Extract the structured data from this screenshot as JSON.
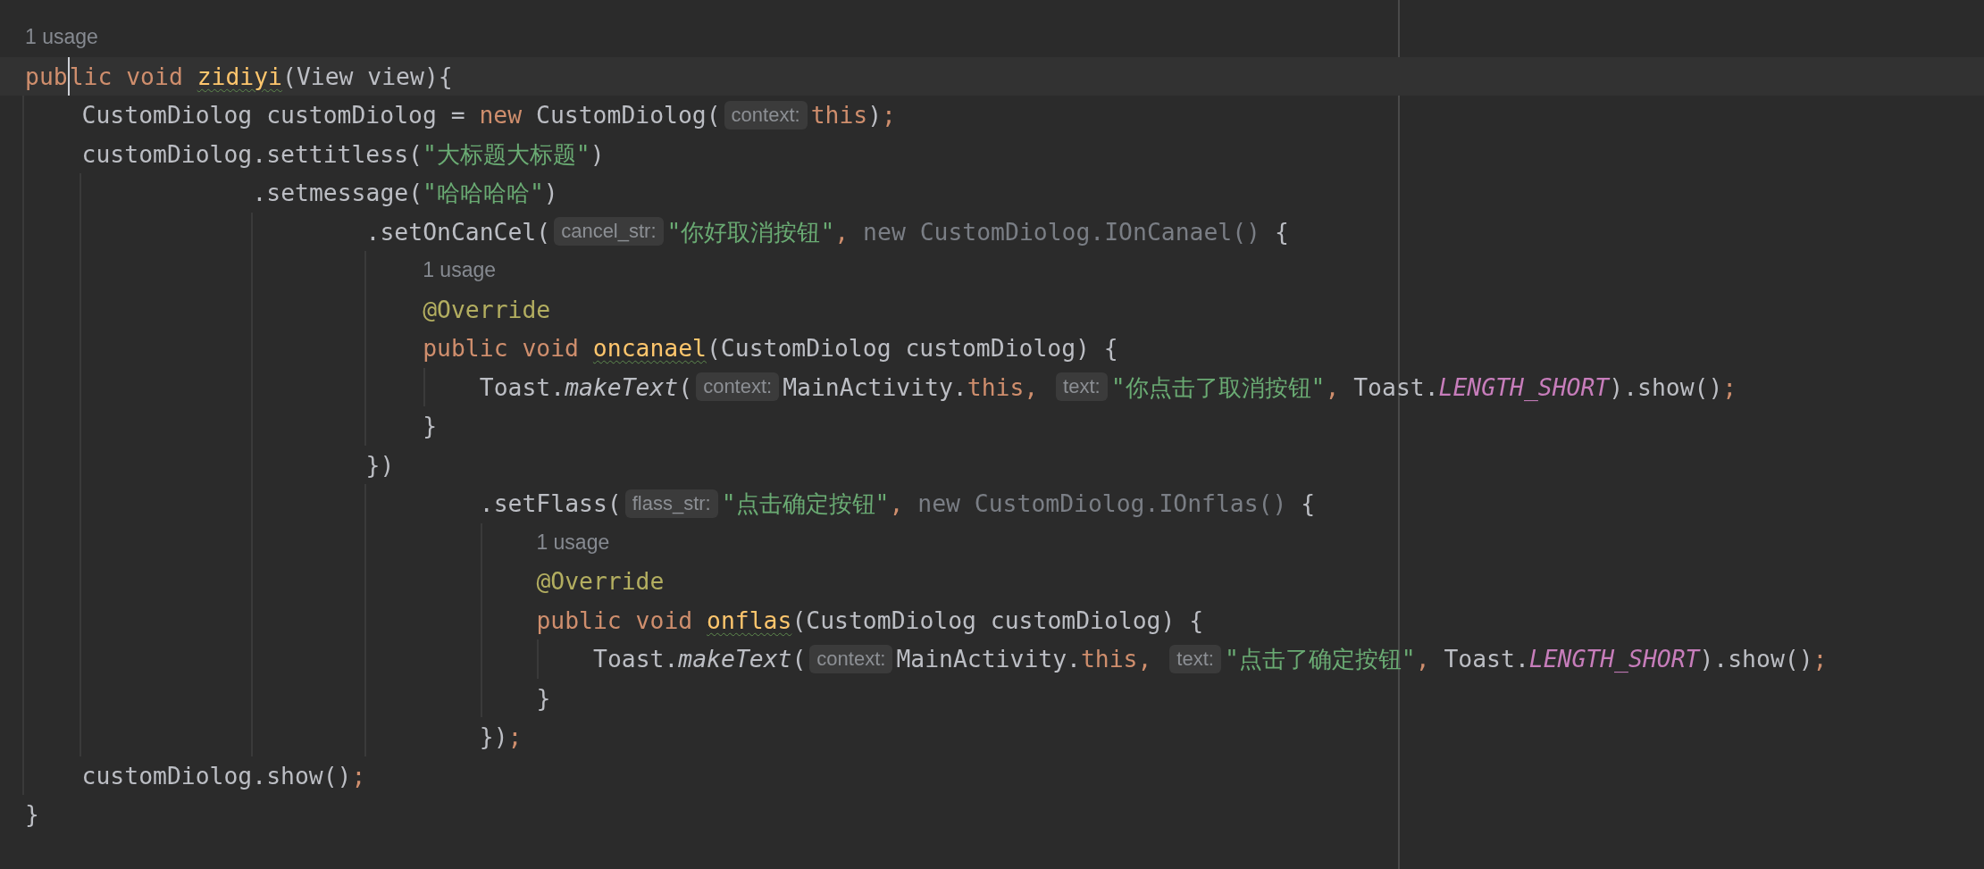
{
  "editor": {
    "lines": [
      {
        "current": false,
        "tokens": [
          {
            "kind": "usage",
            "text": "1 usage"
          }
        ]
      },
      {
        "current": true,
        "tokens": [
          {
            "kind": "keyword",
            "text": "pub"
          },
          {
            "kind": "keyword_caret",
            "text": "lic void "
          },
          {
            "kind": "method",
            "text": "zidiyi"
          },
          {
            "kind": "plain",
            "text": "(View view){"
          }
        ]
      },
      {
        "current": false,
        "tokens": [
          {
            "kind": "plain",
            "text": "    CustomDiolog customDiolog = "
          },
          {
            "kind": "keyword",
            "text": "new "
          },
          {
            "kind": "plain",
            "text": "CustomDiolog("
          },
          {
            "kind": "hint",
            "text": "context:"
          },
          {
            "kind": "keyword",
            "text": "this"
          },
          {
            "kind": "plain",
            "text": ")"
          },
          {
            "kind": "punct",
            "text": ";"
          }
        ]
      },
      {
        "current": false,
        "tokens": [
          {
            "kind": "plain",
            "text": "    customDiolog.settitless("
          },
          {
            "kind": "string",
            "text": "\"大标题大标题\""
          },
          {
            "kind": "plain",
            "text": ")"
          }
        ]
      },
      {
        "current": false,
        "tokens": [
          {
            "kind": "plain",
            "text": "                .setmessage("
          },
          {
            "kind": "string",
            "text": "\"哈哈哈哈\""
          },
          {
            "kind": "plain",
            "text": ")"
          }
        ]
      },
      {
        "current": false,
        "tokens": [
          {
            "kind": "plain",
            "text": "                        .setOnCanCel("
          },
          {
            "kind": "hint",
            "text": "cancel_str:"
          },
          {
            "kind": "string",
            "text": "\"你好取消按钮\""
          },
          {
            "kind": "punct",
            "text": ", "
          },
          {
            "kind": "dim",
            "text": "new CustomDiolog.IOnCanael() "
          },
          {
            "kind": "plain",
            "text": "{"
          }
        ]
      },
      {
        "current": false,
        "tokens": [
          {
            "kind": "usage",
            "text": "                            1 usage"
          }
        ]
      },
      {
        "current": false,
        "tokens": [
          {
            "kind": "annotation",
            "text": "                            @Override"
          }
        ]
      },
      {
        "current": false,
        "tokens": [
          {
            "kind": "keyword",
            "text": "                            public void "
          },
          {
            "kind": "method",
            "text": "oncanael"
          },
          {
            "kind": "plain",
            "text": "(CustomDiolog customDiolog) {"
          }
        ]
      },
      {
        "current": false,
        "tokens": [
          {
            "kind": "plain",
            "text": "                                Toast."
          },
          {
            "kind": "italic",
            "text": "makeText"
          },
          {
            "kind": "plain",
            "text": "("
          },
          {
            "kind": "hint",
            "text": "context:"
          },
          {
            "kind": "plain",
            "text": "MainActivity."
          },
          {
            "kind": "keyword",
            "text": "this"
          },
          {
            "kind": "punct",
            "text": ", "
          },
          {
            "kind": "hint",
            "text": "text:"
          },
          {
            "kind": "string",
            "text": "\"你点击了取消按钮\""
          },
          {
            "kind": "punct",
            "text": ", "
          },
          {
            "kind": "plain",
            "text": "Toast."
          },
          {
            "kind": "constant",
            "text": "LENGTH_SHORT"
          },
          {
            "kind": "plain",
            "text": ").show()"
          },
          {
            "kind": "punct",
            "text": ";"
          }
        ]
      },
      {
        "current": false,
        "tokens": [
          {
            "kind": "plain",
            "text": "                            }"
          }
        ]
      },
      {
        "current": false,
        "tokens": [
          {
            "kind": "plain",
            "text": "                        })"
          }
        ]
      },
      {
        "current": false,
        "tokens": [
          {
            "kind": "plain",
            "text": "                                .setFlass("
          },
          {
            "kind": "hint",
            "text": "flass_str:"
          },
          {
            "kind": "string",
            "text": "\"点击确定按钮\""
          },
          {
            "kind": "punct",
            "text": ", "
          },
          {
            "kind": "dim",
            "text": "new CustomDiolog.IOnflas() "
          },
          {
            "kind": "plain",
            "text": "{"
          }
        ]
      },
      {
        "current": false,
        "tokens": [
          {
            "kind": "usage",
            "text": "                                    1 usage"
          }
        ]
      },
      {
        "current": false,
        "tokens": [
          {
            "kind": "annotation",
            "text": "                                    @Override"
          }
        ]
      },
      {
        "current": false,
        "tokens": [
          {
            "kind": "keyword",
            "text": "                                    public void "
          },
          {
            "kind": "method",
            "text": "onflas"
          },
          {
            "kind": "plain",
            "text": "(CustomDiolog customDiolog) {"
          }
        ]
      },
      {
        "current": false,
        "tokens": [
          {
            "kind": "plain",
            "text": "                                        Toast."
          },
          {
            "kind": "italic",
            "text": "makeText"
          },
          {
            "kind": "plain",
            "text": "("
          },
          {
            "kind": "hint",
            "text": "context:"
          },
          {
            "kind": "plain",
            "text": "MainActivity."
          },
          {
            "kind": "keyword",
            "text": "this"
          },
          {
            "kind": "punct",
            "text": ", "
          },
          {
            "kind": "hint",
            "text": "text:"
          },
          {
            "kind": "string",
            "text": "\"点击了确定按钮\""
          },
          {
            "kind": "punct",
            "text": ", "
          },
          {
            "kind": "plain",
            "text": "Toast."
          },
          {
            "kind": "constant",
            "text": "LENGTH_SHORT"
          },
          {
            "kind": "plain",
            "text": ").show()"
          },
          {
            "kind": "punct",
            "text": ";"
          }
        ]
      },
      {
        "current": false,
        "tokens": [
          {
            "kind": "plain",
            "text": "                                    }"
          }
        ]
      },
      {
        "current": false,
        "tokens": [
          {
            "kind": "plain",
            "text": "                                })"
          },
          {
            "kind": "punct",
            "text": ";"
          }
        ]
      },
      {
        "current": false,
        "tokens": [
          {
            "kind": "plain",
            "text": "    customDiolog.show()"
          },
          {
            "kind": "punct",
            "text": ";"
          }
        ]
      },
      {
        "current": false,
        "tokens": [
          {
            "kind": "plain",
            "text": "}"
          }
        ]
      }
    ]
  }
}
